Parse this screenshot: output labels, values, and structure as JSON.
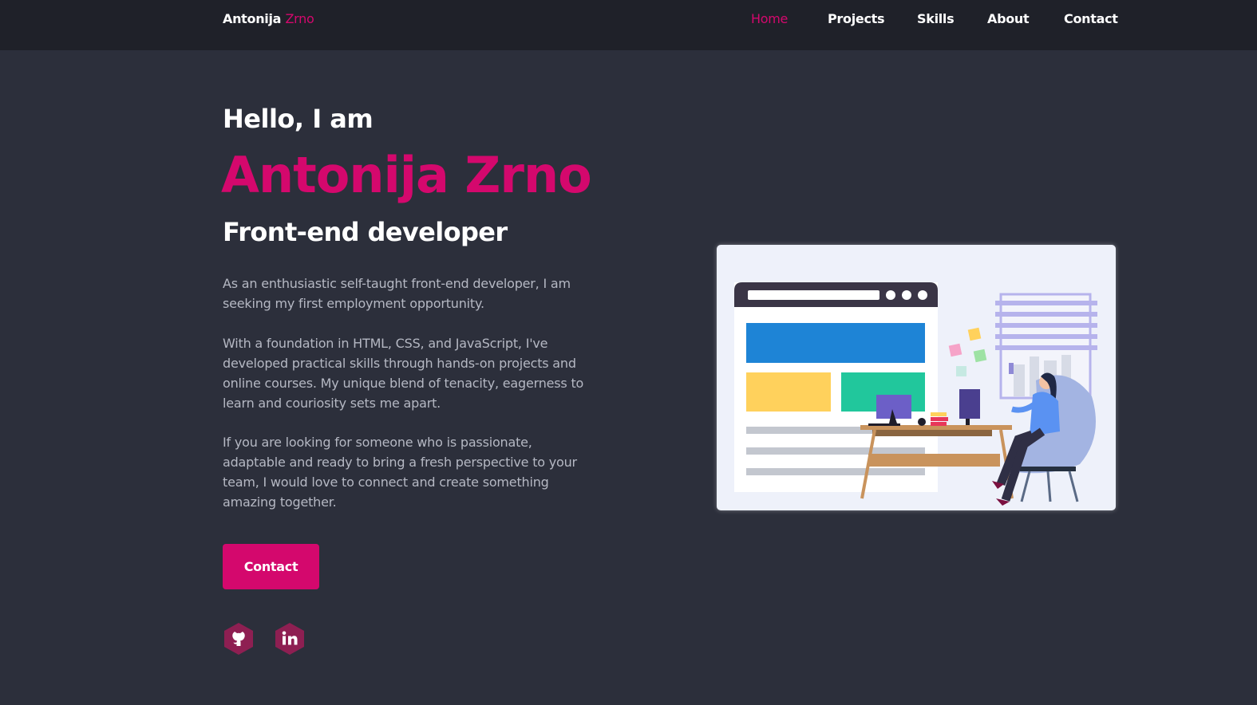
{
  "nav": {
    "brand_first": "Antonija",
    "brand_last": "Zrno",
    "items": [
      {
        "label": "Home",
        "active": true
      },
      {
        "label": "Projects",
        "active": false
      },
      {
        "label": "Skills",
        "active": false
      },
      {
        "label": "About",
        "active": false
      },
      {
        "label": "Contact",
        "active": false
      }
    ]
  },
  "hero": {
    "greeting": "Hello, I am",
    "name": "Antonija Zrno",
    "role": "Front-end developer",
    "paragraphs": [
      "As an enthusiastic self-taught front-end developer, I am seeking my first employment opportunity.",
      "With a foundation in HTML, CSS, and JavaScript, I've developed practical skills through hands-on projects and online courses. My unique blend of tenacity, eagerness to learn and couriosity sets me apart.",
      "If you are looking for someone who is passionate, adaptable and ready to bring a fresh perspective to your team, I would love to connect and create something amazing together."
    ],
    "contact_button": "Contact"
  },
  "social": [
    {
      "icon": "github-icon"
    },
    {
      "icon": "linkedin-icon"
    }
  ],
  "colors": {
    "accent": "#d4086d",
    "background": "#2c2f3b",
    "navbar": "#1f2129",
    "body_text": "#b5b8c3"
  }
}
